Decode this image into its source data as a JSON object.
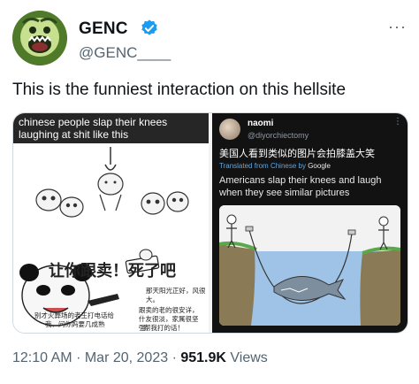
{
  "author": {
    "display_name": "GENC",
    "handle": "@GENC____",
    "more_menu": "···"
  },
  "tweet": {
    "text": "This is the funniest interaction on this hellsite"
  },
  "media": {
    "left": {
      "caption": "chinese people slap their knees laughing at shit like this",
      "headline": "让你跟卖！死了吧",
      "bubble_1": "别才火葬场的老王打电话给",
      "bubble_1b": "我，问你妈要几成熟",
      "bubble_2": "那天阳光正好，风很大。",
      "bubble_3": "跟卖的老的很安详，",
      "bubble_3b": "什友很淡，家属很坚强，",
      "bubble_3c": "帮我打的话！"
    },
    "right": {
      "name": "naomi",
      "handle": "@diyorchiectomy",
      "more_menu": "⋮",
      "chinese_text": "美国人看到类似的图片会拍膝盖大笑",
      "translated_label": "Translated from Chinese by",
      "translated_by": "Google",
      "english_text": "Americans slap their knees and laugh when they see similar pictures"
    }
  },
  "footer": {
    "time": "12:10 AM",
    "date": "Mar 20, 2023",
    "separator": "·",
    "views_count": "951.9K",
    "views_label": "Views"
  },
  "colors": {
    "text_primary": "#0f1419",
    "text_secondary": "#536471",
    "verified_blue": "#1d9bf0"
  },
  "icons": [
    "verified-badge-icon",
    "more-options-icon"
  ]
}
